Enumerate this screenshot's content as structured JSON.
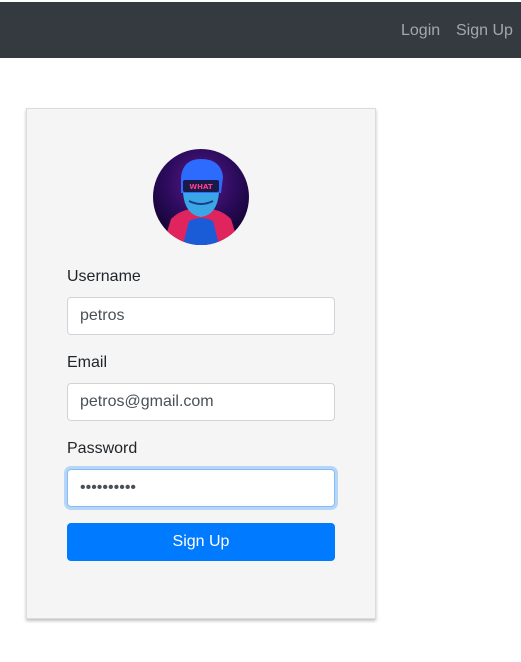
{
  "navbar": {
    "login_label": "Login",
    "signup_label": "Sign Up"
  },
  "avatar": {
    "caption": "WHAT"
  },
  "form": {
    "username_label": "Username",
    "username_value": "petros",
    "email_label": "Email",
    "email_value": "petros@gmail.com",
    "password_label": "Password",
    "password_value": "••••••••••",
    "submit_label": "Sign Up"
  },
  "colors": {
    "navbar_bg": "#343a40",
    "primary": "#007bff",
    "card_bg": "#f5f5f5"
  }
}
